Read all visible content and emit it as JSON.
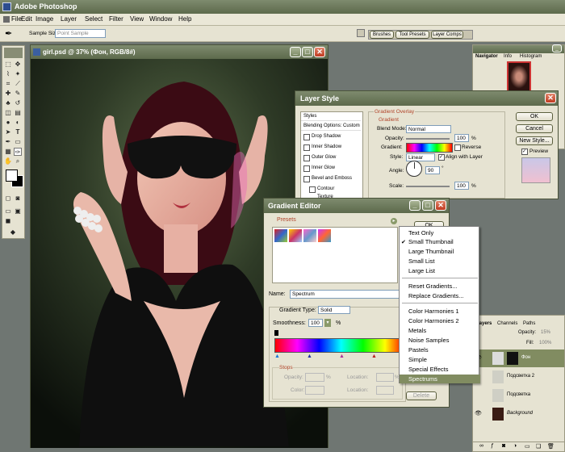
{
  "app": {
    "title": "Adobe Photoshop"
  },
  "menu": [
    "File",
    "Edit",
    "Image",
    "Layer",
    "Select",
    "Filter",
    "View",
    "Window",
    "Help"
  ],
  "options_bar": {
    "sample_size_label": "Sample Size:",
    "sample_size_value": "Point Sample"
  },
  "palette_well": [
    "Brushes",
    "Tool Presets",
    "Layer Comps"
  ],
  "document": {
    "title": "girl.psd @ 37% (Фон, RGB/8#)"
  },
  "navigator": {
    "tabs": [
      "Navigator",
      "Info",
      "Histogram"
    ]
  },
  "layer_style": {
    "title": "Layer Style",
    "styles_header": "Styles",
    "blending_options": "Blending Options: Custom",
    "effects": [
      "Drop Shadow",
      "Inner Shadow",
      "Outer Glow",
      "Inner Glow",
      "Bevel and Emboss",
      "Contour",
      "Texture"
    ],
    "section_title": "Gradient Overlay",
    "group_title": "Gradient",
    "blend_mode_label": "Blend Mode:",
    "blend_mode_value": "Normal",
    "opacity_label": "Opacity:",
    "opacity_value": "100",
    "gradient_label": "Gradient:",
    "reverse_label": "Reverse",
    "style_label": "Style:",
    "style_value": "Linear",
    "align_label": "Align with Layer",
    "angle_label": "Angle:",
    "angle_value": "90",
    "scale_label": "Scale:",
    "scale_value": "100",
    "percent": "%",
    "ok": "OK",
    "cancel": "Cancel",
    "new_style": "New Style...",
    "preview": "Preview"
  },
  "gradient_editor": {
    "title": "Gradient Editor",
    "presets_label": "Presets",
    "ok": "OK",
    "name_label": "Name:",
    "name_value": "Spectrum",
    "gradient_type_label": "Gradient Type:",
    "gradient_type_value": "Solid",
    "smoothness_label": "Smoothness:",
    "smoothness_value": "100",
    "percent": "%",
    "stops_label": "Stops",
    "opacity_label": "Opacity:",
    "location_label": "Location:",
    "color_label": "Color:",
    "delete": "Delete"
  },
  "context_menu": {
    "group1": [
      "Text Only",
      "Small Thumbnail",
      "Large Thumbnail",
      "Small List",
      "Large List"
    ],
    "group2": [
      "Reset Gradients...",
      "Replace Gradients..."
    ],
    "group3": [
      "Color Harmonies 1",
      "Color Harmonies 2",
      "Metals",
      "Noise Samples",
      "Pastels",
      "Simple",
      "Special Effects",
      "Spectrums"
    ],
    "checked": "Small Thumbnail",
    "highlighted": "Spectrums"
  },
  "layers_panel": {
    "tabs": [
      "Layers",
      "Channels",
      "Paths"
    ],
    "opacity_label": "Opacity:",
    "opacity_value": "15%",
    "fill_label": "Fill:",
    "fill_value": "100%",
    "layers": [
      "Фон",
      "Подсветка 2",
      "Подсветка",
      "Background"
    ]
  },
  "colors": {
    "title_bar": "#6e7b5c",
    "highlight": "#818c61",
    "panel": "#e6e3d2",
    "workspace": "#6f7672"
  }
}
